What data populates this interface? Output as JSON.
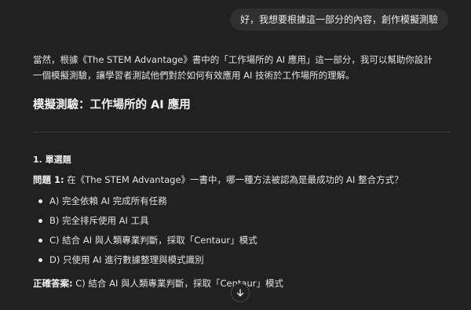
{
  "user_message": "好，我想要根據這一部分的內容，創作模擬測驗",
  "assistant": {
    "intro": "當然，根據《The STEM Advantage》書中的「工作場所的 AI 應用」這一部分，我可以幫助你設計一個模擬測驗，讓學習者測試他們對於如何有效應用 AI 技術於工作場所的理解。",
    "heading": "模擬測驗：工作場所的 AI 應用",
    "section_title": "1. 單選題",
    "question_label": "問題 1:",
    "question_text": " 在《The STEM Advantage》一書中，哪一種方法被認為是最成功的 AI 整合方式？",
    "options": [
      "A) 完全依賴 AI 完成所有任務",
      "B) 完全排斥使用 AI 工具",
      "C) 結合 AI 與人類專業判斷，採取「Centaur」模式",
      "D) 只使用 AI 進行數據整理與模式識別"
    ],
    "answer_label": "正確答案:",
    "answer_text": " C) 結合 AI 與人類專業判斷，採取「Centaur」模式"
  },
  "icons": {
    "scroll_down": "arrow-down-icon"
  },
  "colors": {
    "background": "#212121",
    "bubble": "#303030",
    "text": "#ececec"
  }
}
